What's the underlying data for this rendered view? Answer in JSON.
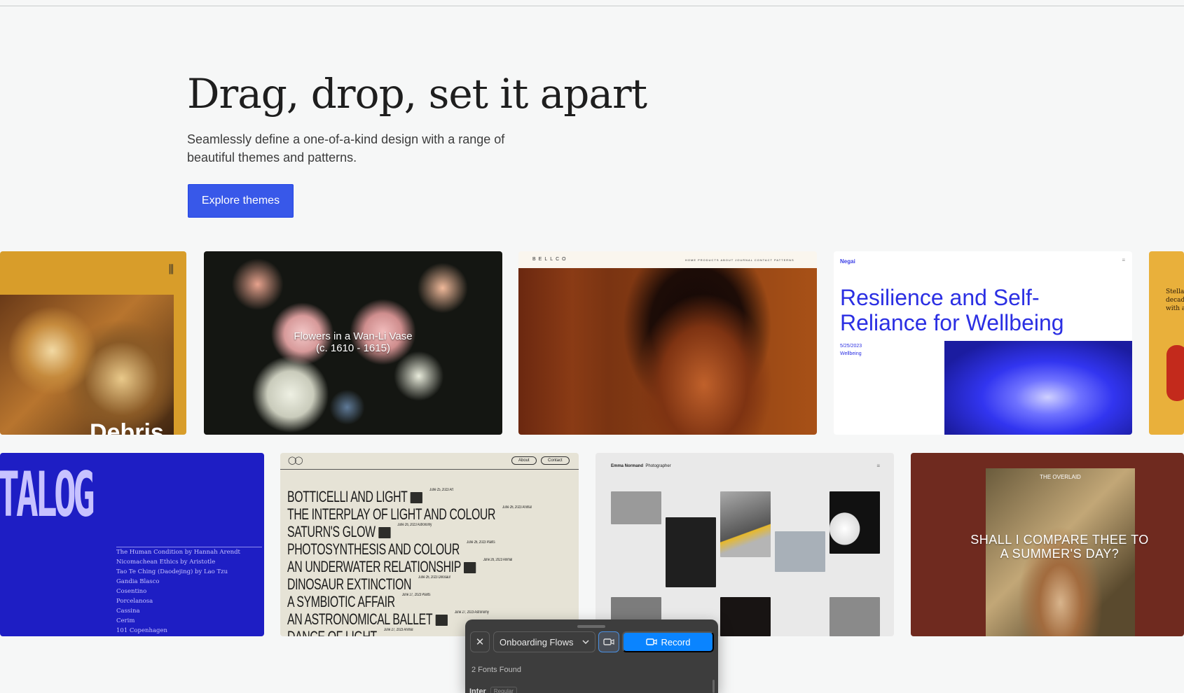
{
  "hero": {
    "title": "Drag, drop, set it apart",
    "subtitle": "Seamlessly define a one-of-a-kind design with a range of beautiful themes and patterns.",
    "cta": "Explore themes"
  },
  "themes_row1": {
    "c1": {
      "word": "Debris"
    },
    "c2": {
      "title_line1": "Flowers in a Wan-Li Vase",
      "title_line2": "(c. 1610 - 1615)"
    },
    "c3": {
      "brand": "BELLCO",
      "nav": "HOME   PRODUCTS   ABOUT   JOURNAL   CONTACT   PATTERNS"
    },
    "c4": {
      "brand": "Negai",
      "title": "Resilience and Self-Reliance for Wellbeing",
      "date": "5/25/2023",
      "category": "Wellbeing"
    },
    "c5": {
      "line1": "Stella",
      "line2": "decad",
      "line3": "with a"
    }
  },
  "themes_row2": {
    "d1": {
      "big": "TALOG",
      "items": [
        "The Human Condition by Hannah Arendt",
        "Nicomachean Ethics by Aristotle",
        "Tao Te Ching (Daodejing) by Lao Tzu",
        "Gandia Blasco",
        "Cosentino",
        "Porcelanosa",
        "Cassina",
        "Cerim",
        "101 Copenhagen"
      ]
    },
    "d2": {
      "about": "About",
      "contact": "Contact",
      "items": [
        {
          "title": "BOTTICELLI AND LIGHT",
          "meta": "June 25, 2023 Art"
        },
        {
          "title": "THE INTERPLAY OF LIGHT AND COLOUR",
          "meta": "June 26, 2023 Animal"
        },
        {
          "title": "SATURN'S GLOW",
          "meta": "June 26, 2023 Astronomy"
        },
        {
          "title": "PHOTOSYNTHESIS AND COLOUR",
          "meta": "June 26, 2023 Plants"
        },
        {
          "title": "AN UNDERWATER RELATIONSHIP",
          "meta": "June 26, 2023 Animal"
        },
        {
          "title": "DINOSAUR EXTINCTION",
          "meta": "June 26, 2023 Dinosaur"
        },
        {
          "title": "A SYMBIOTIC AFFAIR",
          "meta": "June 27, 2023 Plants"
        },
        {
          "title": "AN ASTRONOMICAL BALLET",
          "meta": "June 27, 2023 Astronomy"
        },
        {
          "title": "DANCE OF LIGHT",
          "meta": "June 27, 2023 Animal"
        }
      ]
    },
    "d3": {
      "name": "Emma Normand",
      "role": "Photographer"
    },
    "d4": {
      "kicker": "THE OVERLAID",
      "quote": "SHALL I COMPARE THEE TO A SUMMER'S DAY?"
    }
  },
  "toolbar": {
    "close_glyph": "✕",
    "select_value": "Onboarding Flows",
    "record_label": "Record",
    "fonts_found": "2 Fonts Found",
    "font_name": "Inter",
    "font_style": "Regular"
  }
}
